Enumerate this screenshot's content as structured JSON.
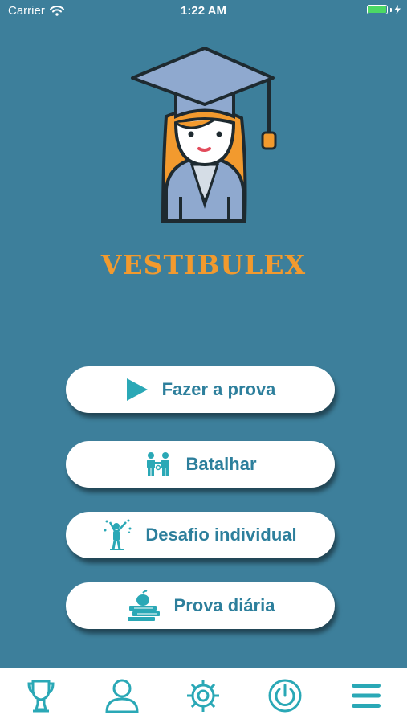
{
  "status_bar": {
    "carrier": "Carrier",
    "time": "1:22 AM",
    "battery_level": 1.0
  },
  "app": {
    "title": "VESTIBULEX",
    "title_color": "#f29a2e"
  },
  "colors": {
    "background": "#3d7f9b",
    "accent": "#2aa8b6",
    "button_text": "#2d7f9c"
  },
  "menu": {
    "items": [
      {
        "label": "Fazer a prova",
        "icon": "play-icon"
      },
      {
        "label": "Batalhar",
        "icon": "battle-people-icon"
      },
      {
        "label": "Desafio individual",
        "icon": "celebration-person-icon"
      },
      {
        "label": "Prova diária",
        "icon": "books-apple-icon"
      }
    ]
  },
  "tab_bar": {
    "items": [
      {
        "icon": "trophy-icon"
      },
      {
        "icon": "user-icon"
      },
      {
        "icon": "gear-icon"
      },
      {
        "icon": "power-icon"
      },
      {
        "icon": "menu-icon"
      }
    ]
  }
}
